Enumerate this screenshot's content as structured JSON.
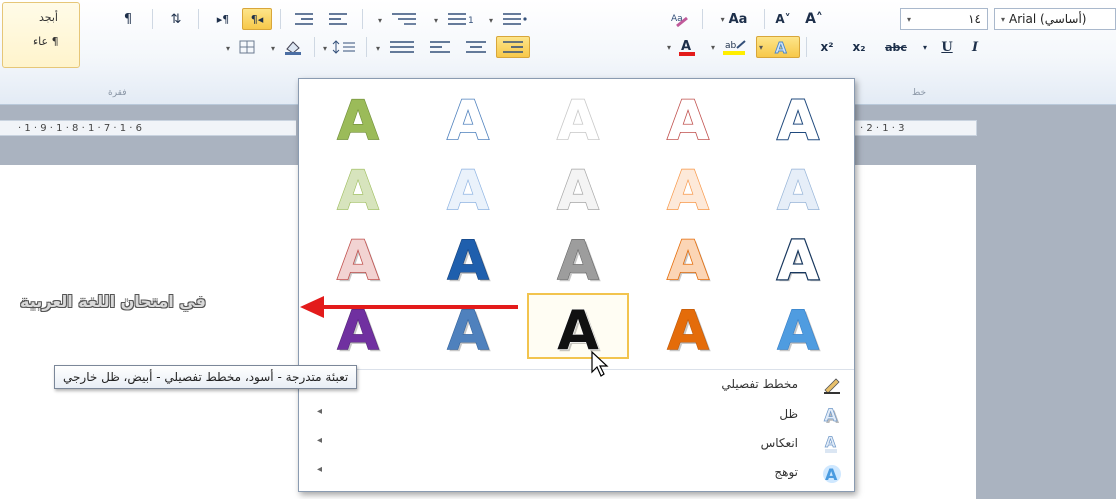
{
  "ribbon": {
    "find_label": "أبجد",
    "style_label": "عاء ¶",
    "paragraph_group_label": "فقرة",
    "font_group_label": "خط",
    "font_size": "١٤",
    "font_name": "Arial (أساسي)",
    "pilcrow_glyph": "¶",
    "sort_glyph": "⇅",
    "ltr_glyph": "▸¶",
    "rtl_glyph": "¶◂",
    "grow_font_glyph": "A˄",
    "change_case_glyph": "Aa",
    "superscript_glyph": "x²",
    "subscript_glyph": "x₂",
    "strikethrough_glyph": "abc",
    "underline_glyph": "U",
    "italic_glyph": "I"
  },
  "ruler": {
    "left_numbers": "· 1 · 9 · 1 · 8 · 1 · 7 · 1 · 6",
    "right_numbers": "· 2 · 1 · 3"
  },
  "document": {
    "body_text": "في امتحان اللغة العربية"
  },
  "gallery": {
    "tile_letter": "A",
    "options": [
      {
        "label": "مخطط تفصيلي",
        "icon": "outline-pen-icon",
        "has_submenu": false
      },
      {
        "label": "ظل",
        "icon": "shadow-icon",
        "has_submenu": true
      },
      {
        "label": "انعكاس",
        "icon": "reflection-icon",
        "has_submenu": true
      },
      {
        "label": "توهج",
        "icon": "glow-icon",
        "has_submenu": true
      }
    ],
    "submenu_arrow": "◂"
  },
  "tooltip": {
    "text": "تعبئة متدرجة - أسود، مخطط تفصيلي - أبيض، ظل خارجي"
  },
  "colors": {
    "accent_red": "#e31b1b",
    "hover_border": "#f2c44e",
    "gallery_border": "#8a9bb1"
  }
}
